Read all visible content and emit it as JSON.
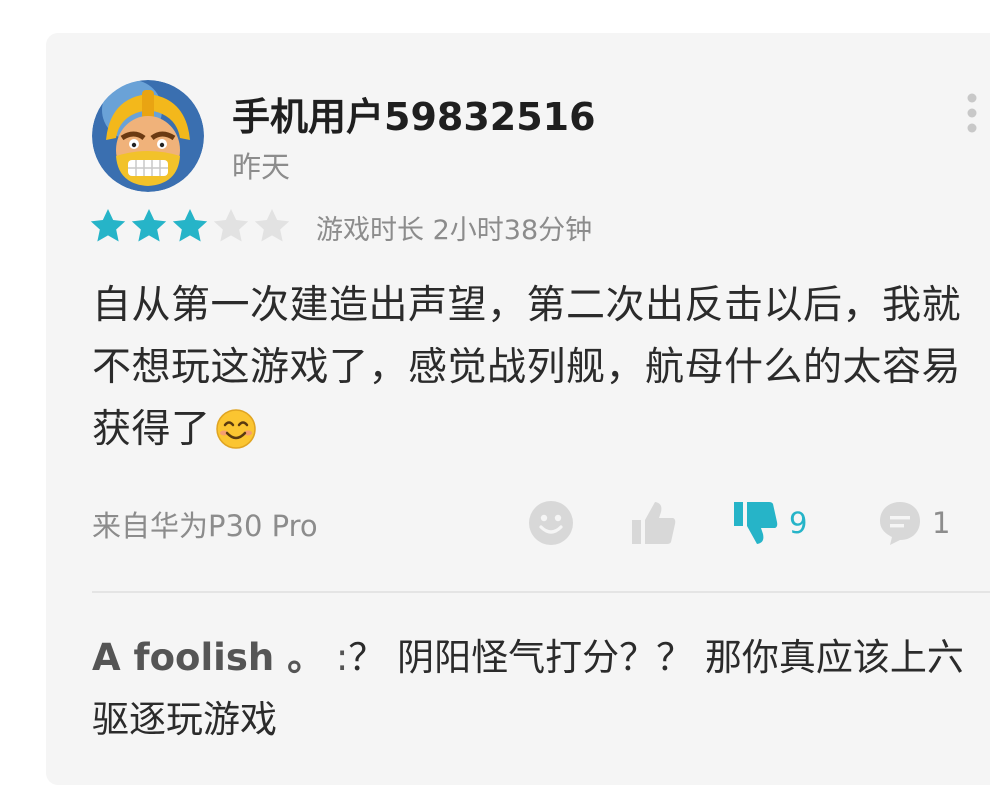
{
  "review": {
    "username": "手机用户59832516",
    "date": "昨天",
    "rating": 3,
    "rating_max": 5,
    "playtime": "游戏时长 2小时38分钟",
    "text": "自从第一次建造出声望，第二次出反击以后，我就不想玩这游戏了，感觉战列舰，航母什么的太容易获得了",
    "device": "来自华为P30 Pro",
    "actions": {
      "dislike_count": "9",
      "comment_count": "1"
    }
  },
  "reply": {
    "author": "A foolish 。",
    "separator": ":",
    "text": "？ 阴阳怪气打分？？ 那你真应该上六驱逐玩游戏"
  },
  "colors": {
    "accent": "#26b4c8",
    "star_empty": "#e2e2e2",
    "icon_gray": "#d8d8d8",
    "text_secondary": "#8c8c8c",
    "card_background": "#f5f5f5"
  },
  "icons": {
    "avatar": "clash-barbarian-avatar",
    "more": "more-vertical-icon",
    "emoji": "smiling-face-emoji",
    "reaction": "smiley-icon",
    "like": "thumbs-up-icon",
    "dislike": "thumbs-down-icon",
    "comment": "comment-bubble-icon"
  }
}
